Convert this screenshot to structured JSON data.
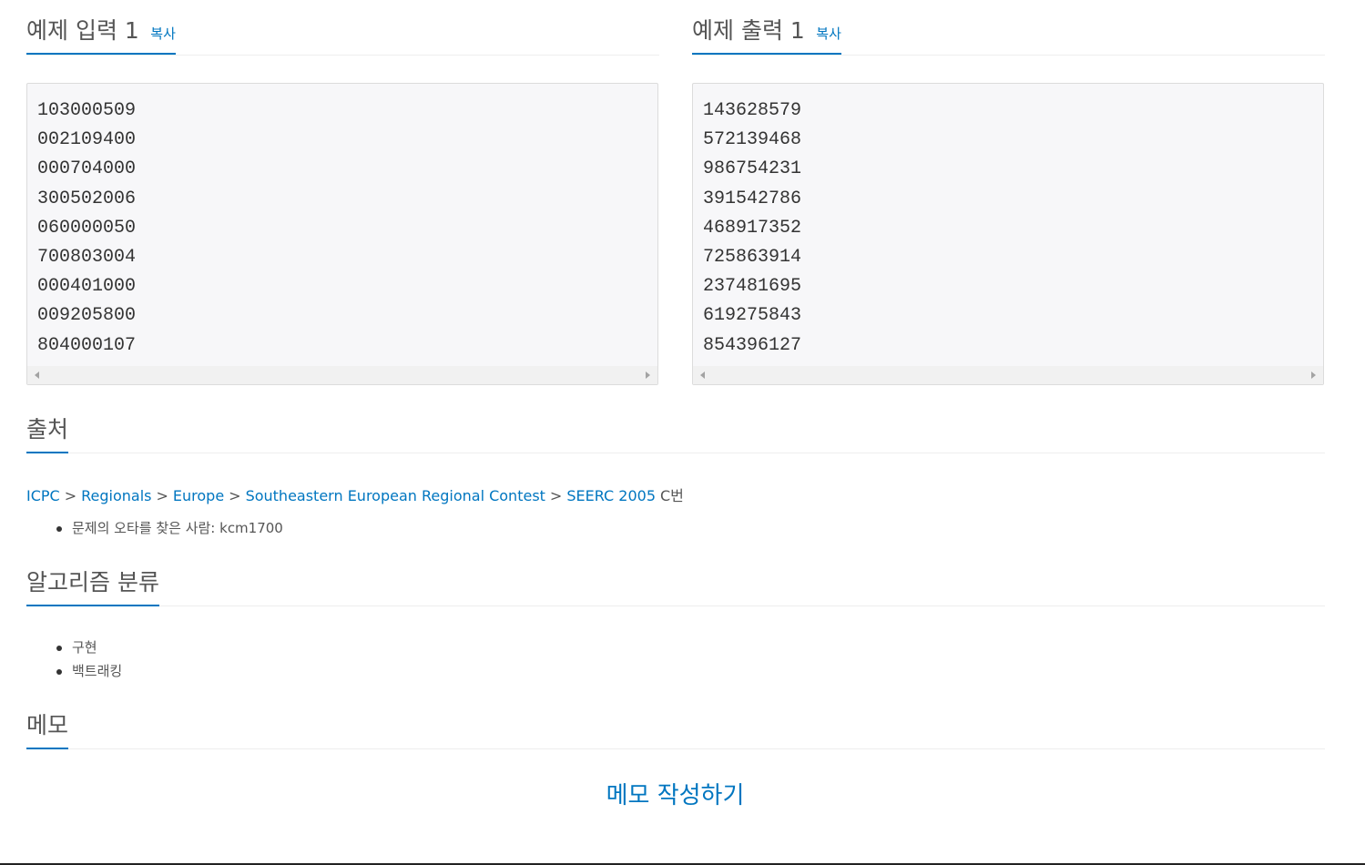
{
  "sample_input": {
    "title": "예제 입력 1",
    "copy_label": "복사",
    "lines": [
      "103000509",
      "002109400",
      "000704000",
      "300502006",
      "060000050",
      "700803004",
      "000401000",
      "009205800",
      "804000107"
    ]
  },
  "sample_output": {
    "title": "예제 출력 1",
    "copy_label": "복사",
    "lines": [
      "143628579",
      "572139468",
      "986754231",
      "391542786",
      "468917352",
      "725863914",
      "237481695",
      "619275843",
      "854396127"
    ]
  },
  "source": {
    "title": "출처",
    "breadcrumb": [
      "ICPC",
      "Regionals",
      "Europe",
      "Southeastern European Regional Contest",
      "SEERC 2005"
    ],
    "separator": ">",
    "suffix": "C번",
    "notes": [
      "문제의 오타를 찾은 사람: kcm1700"
    ]
  },
  "algorithms": {
    "title": "알고리즘 분류",
    "items": [
      "구현",
      "백트래킹"
    ]
  },
  "memo": {
    "title": "메모",
    "write_label": "메모 작성하기"
  },
  "colors": {
    "accent": "#0076c0",
    "heading": "#555555",
    "pre_bg": "#f7f7f9"
  }
}
